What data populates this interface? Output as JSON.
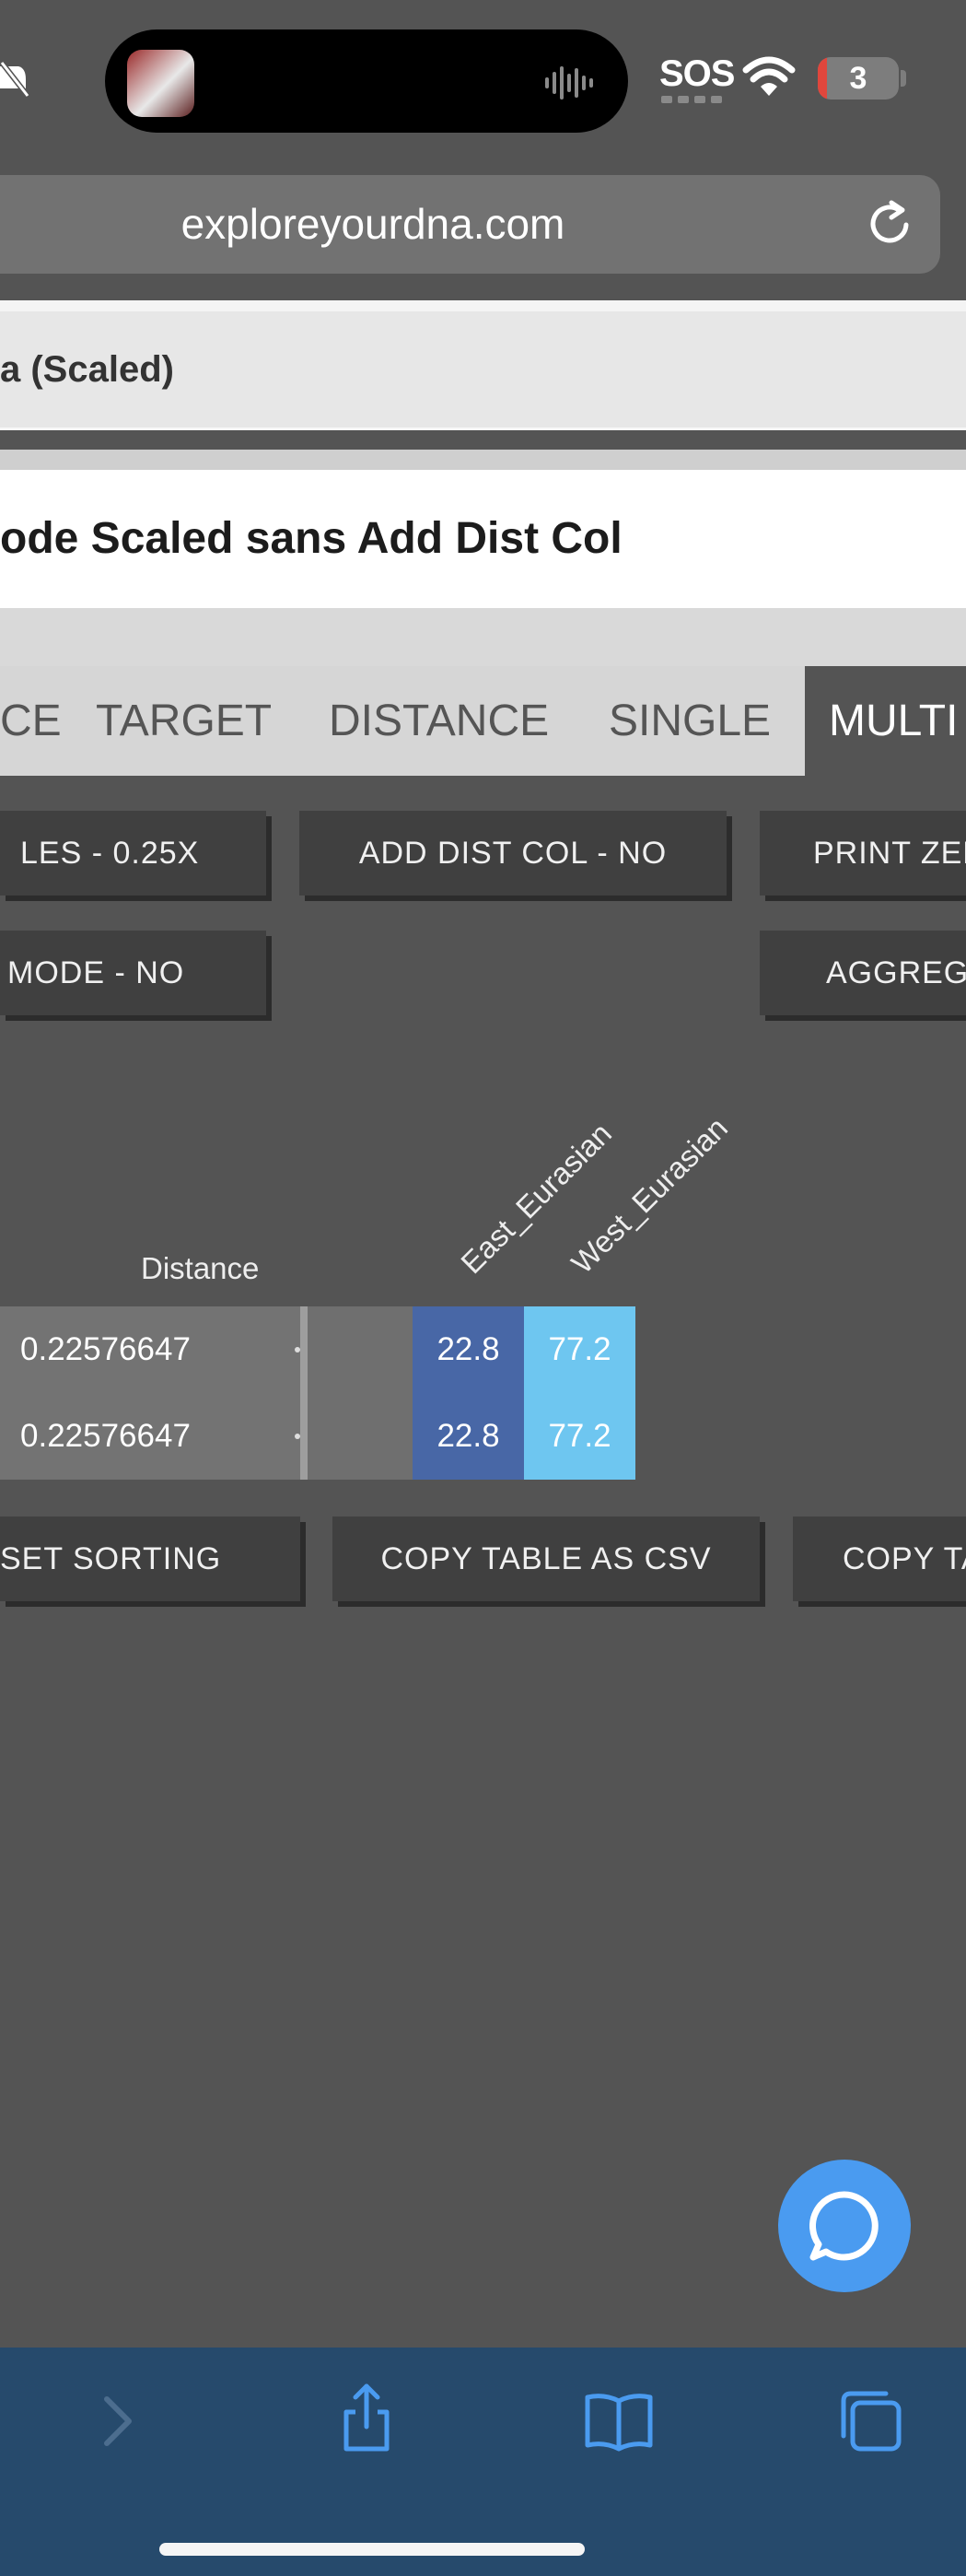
{
  "status_bar": {
    "sos": "SOS",
    "battery": "3"
  },
  "browser": {
    "url": "exploreyourdna.com"
  },
  "page": {
    "breadcrumb": "a (Scaled)",
    "title": "ode Scaled sans Add Dist Col",
    "tabs": [
      "CE",
      "TARGET",
      "DISTANCE",
      "SINGLE",
      "MULTI"
    ],
    "active_tab": "MULTI",
    "option_buttons": {
      "scales": "LES - 0.25X",
      "add_dist_col": "ADD DIST COL - NO",
      "print_zero": "PRINT ZER",
      "mode": "MODE - NO",
      "aggregate": "AGGREGA"
    },
    "table": {
      "columns": [
        "Distance",
        "East_Eurasian",
        "West_Eurasian"
      ],
      "rows": [
        {
          "distance": "0.22576647",
          "east": "22.8",
          "west": "77.2"
        },
        {
          "distance": "0.22576647",
          "east": "22.8",
          "west": "77.2"
        }
      ]
    },
    "action_buttons": {
      "reset_sorting": "SET SORTING",
      "copy_csv": "COPY TABLE AS CSV",
      "copy_table": "COPY TA"
    }
  },
  "colors": {
    "page_bg": "#545454",
    "east_cell": "#4867a6",
    "west_cell": "#6ec6f0",
    "chat_button": "#4a9bf0",
    "toolbar_bg": "#264a6c"
  },
  "icons": [
    "bell-slash-icon",
    "waveform-icon",
    "wifi-icon",
    "reload-icon",
    "chat-icon",
    "forward-icon",
    "share-icon",
    "bookmarks-icon",
    "tabs-icon"
  ]
}
